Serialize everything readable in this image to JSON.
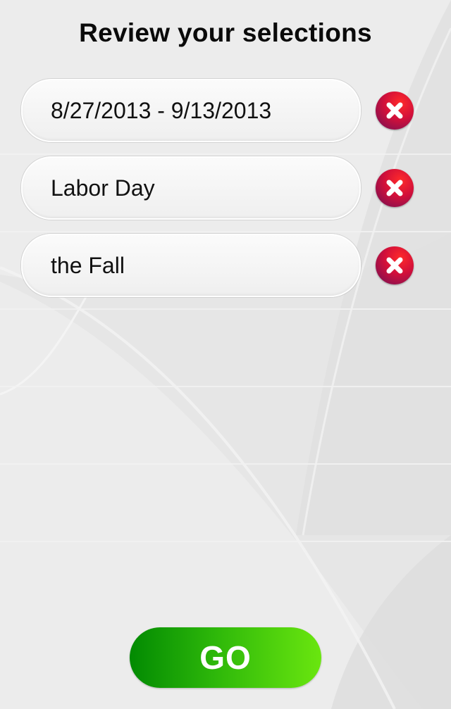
{
  "header": {
    "title": "Review your selections"
  },
  "selections": [
    {
      "label": "8/27/2013 - 9/13/2013",
      "remove_icon": "close-x-icon"
    },
    {
      "label": "Labor Day",
      "remove_icon": "close-x-icon"
    },
    {
      "label": "the Fall",
      "remove_icon": "close-x-icon"
    }
  ],
  "footer": {
    "go_label": "GO"
  },
  "colors": {
    "remove_button": "#d10f3a",
    "go_button_start": "#028a02",
    "go_button_end": "#6ae60f"
  }
}
